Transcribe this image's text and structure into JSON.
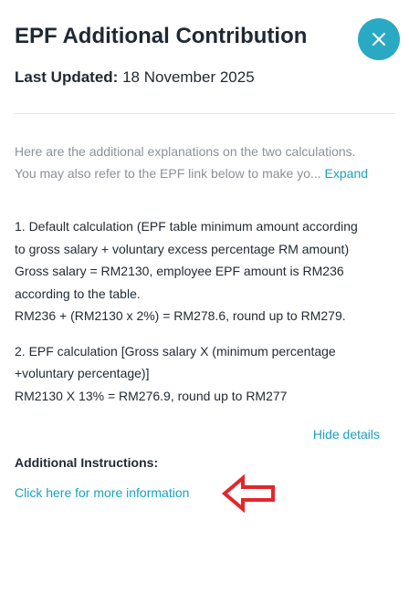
{
  "header": {
    "title": "EPF Additional Contribution",
    "close_icon": "close-icon",
    "accent_color": "#2aa9c5"
  },
  "last_updated": {
    "label": "Last Updated:",
    "value": "18 November 2025"
  },
  "intro": {
    "line1": "Here are the additional explanations on the two calculations.",
    "line2": "You may also refer to the EPF link below to make yo...",
    "expand_label": "Expand"
  },
  "details": {
    "lines": [
      "1. Default calculation (EPF table minimum amount according",
      "to gross salary + voluntary excess percentage RM amount)",
      "Gross salary = RM2130, employee EPF amount is RM236",
      "according to the table.",
      "RM236 + (RM2130 x 2%) = RM278.6, round up to RM279.",
      "2. EPF calculation [Gross salary X (minimum percentage",
      "+voluntary percentage)]",
      "RM2130 X 13% = RM276.9, round up to RM277"
    ]
  },
  "hide_details_label": "Hide details",
  "additional_instructions": {
    "heading": "Additional Instructions:",
    "link_label": "Click here for more information"
  },
  "annotation": {
    "arrow_icon": "left-arrow-icon",
    "color": "#e3262b"
  }
}
